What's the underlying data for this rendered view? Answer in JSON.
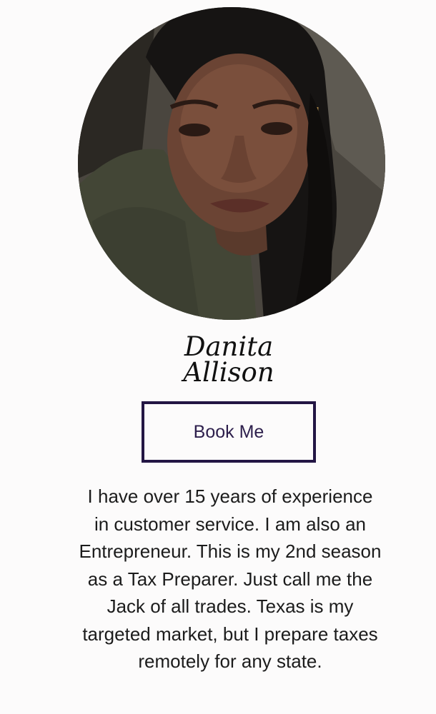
{
  "profile": {
    "photo_alt": "Portrait photo",
    "name_first": "Danita",
    "name_last": "Allison",
    "book_button_label": "Book Me",
    "bio_lines": [
      "I have over 15 years of experience",
      "in customer service.  I am also an",
      "Entrepreneur.  This is my 2nd season",
      "as a Tax Preparer.  Just call me the",
      "Jack of all trades. Texas is my",
      "targeted market, but I prepare taxes",
      "remotely for any state."
    ]
  },
  "colors": {
    "background": "#fcfbfb",
    "button_border": "#231644",
    "button_text": "#2d1f4c",
    "text": "#1c1c1c"
  }
}
